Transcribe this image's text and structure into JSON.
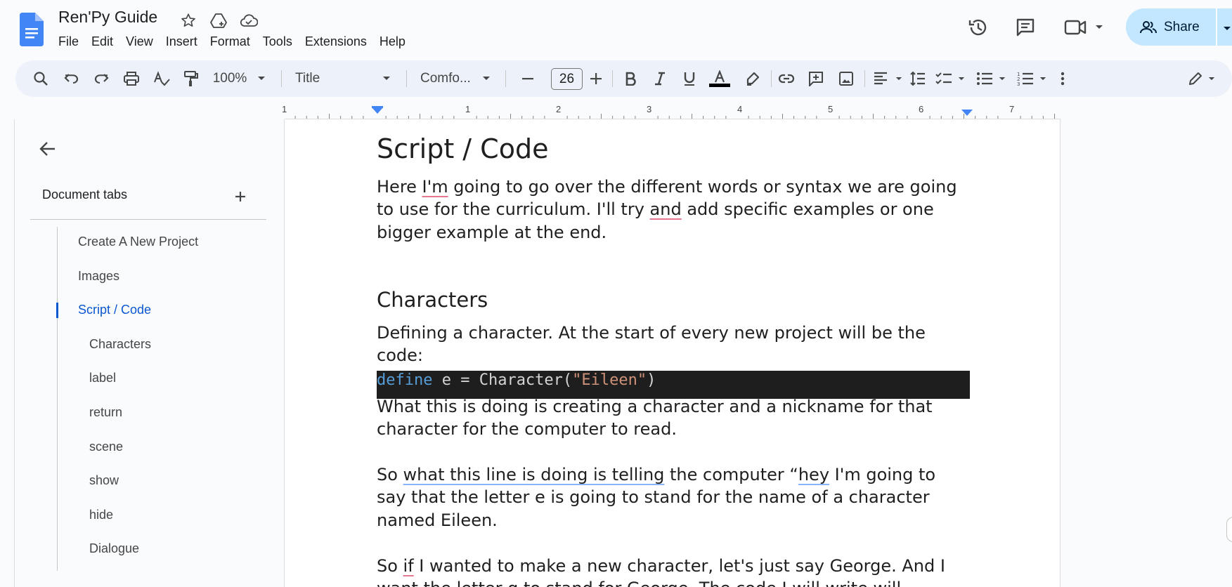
{
  "app": {
    "title": "Ren'Py Guide",
    "menu": [
      "File",
      "Edit",
      "View",
      "Insert",
      "Format",
      "Tools",
      "Extensions",
      "Help"
    ],
    "share_label": "Share",
    "accent": "#0b57d0",
    "share_bg": "#c2e7ff"
  },
  "toolbar": {
    "zoom": "100%",
    "style": "Title",
    "font": "Comfo...",
    "font_size": "26"
  },
  "ruler": {
    "numbers": [
      "1",
      "1",
      "2",
      "3",
      "4",
      "5",
      "6",
      "7"
    ]
  },
  "sidebar": {
    "heading": "Document tabs",
    "tabs": [
      {
        "label": "Create A New Project"
      },
      {
        "label": "Images"
      },
      {
        "label": "Script / Code"
      },
      {
        "label": "Characters"
      },
      {
        "label": "label"
      },
      {
        "label": "return"
      },
      {
        "label": "scene"
      },
      {
        "label": "show"
      },
      {
        "label": "hide"
      },
      {
        "label": "Dialogue"
      }
    ]
  },
  "document": {
    "title": "Script / Code",
    "intro": {
      "p1": "Here ",
      "w1": "I'm",
      "p2": " going to go over the different words or syntax we are going to use for the curriculum. I'll try ",
      "w2": "and",
      "p3": " add specific examples or one bigger example at the end."
    },
    "heading_characters": "Characters",
    "defining": "Defining a character. At the start of every new project will be the code:",
    "code": {
      "keyword": "define",
      "middle": " e = Character(",
      "string": "\"Eileen\"",
      "end": ")"
    },
    "what_this": "What this is doing is creating a character and a nickname for that character for the computer to read.",
    "so_what": {
      "p1": "So ",
      "w1": "what this line is doing is telling",
      "p2": " the computer “",
      "w2": "hey",
      "p3": " I'm going to say that the letter e is going to stand for the name of a character named Eileen."
    },
    "so_if": {
      "p1": "So ",
      "w1": "if",
      "p2": " I wanted to make a new character, let's just say George. And I want the letter g to stand for George. The code I will write will"
    }
  }
}
